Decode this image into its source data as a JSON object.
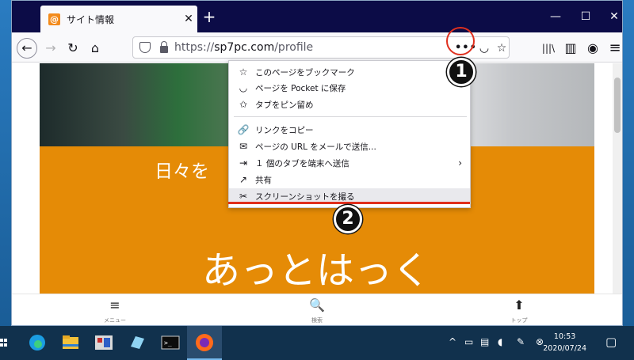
{
  "tab": {
    "favicon": "@",
    "title": "サイト情報",
    "close": "✕",
    "new": "+"
  },
  "window_controls": {
    "minimize": "—",
    "maximize": "☐",
    "close": "✕"
  },
  "nav": {
    "back": "←",
    "forward": "→",
    "reload": "↻",
    "home": "⌂",
    "url_prefix": "https://",
    "url_host": "sp7pc.com",
    "url_path": "/profile",
    "page_actions": "•••",
    "pocket": "◡",
    "bookmark": "☆",
    "library": "|||\\",
    "sidebar": "▥",
    "account": "◉",
    "menu": "≡"
  },
  "content": {
    "banner_text": "日々を",
    "headline": "あっとはっく"
  },
  "bottom_nav": [
    {
      "icon": "≡",
      "label": "メニュー"
    },
    {
      "icon": "🔍",
      "label": "検索"
    },
    {
      "icon": "⬆",
      "label": "トップ"
    }
  ],
  "menu": {
    "items": [
      {
        "icon": "☆",
        "label": "このページをブックマーク"
      },
      {
        "icon": "◡",
        "label": "ページを Pocket に保存"
      },
      {
        "icon": "✩",
        "label": "タブをピン留め"
      },
      {
        "icon": "🔗",
        "label": "リンクをコピー"
      },
      {
        "icon": "✉",
        "label": "ページの URL をメールで送信..."
      },
      {
        "icon": "⇥",
        "label": "１ 個のタブを端末へ送信",
        "arrow": "›"
      },
      {
        "icon": "↗",
        "label": "共有"
      },
      {
        "icon": "✂",
        "label": "スクリーンショットを撮る"
      }
    ]
  },
  "annotations": {
    "step1": "1",
    "step2": "2"
  },
  "taskbar": {
    "time": "10:53",
    "date": "2020/07/24",
    "tray_up": "^"
  },
  "colors": {
    "accent_orange": "#e58b06",
    "annotation_red": "#e0301e",
    "tabbar": "#0c0c47"
  }
}
